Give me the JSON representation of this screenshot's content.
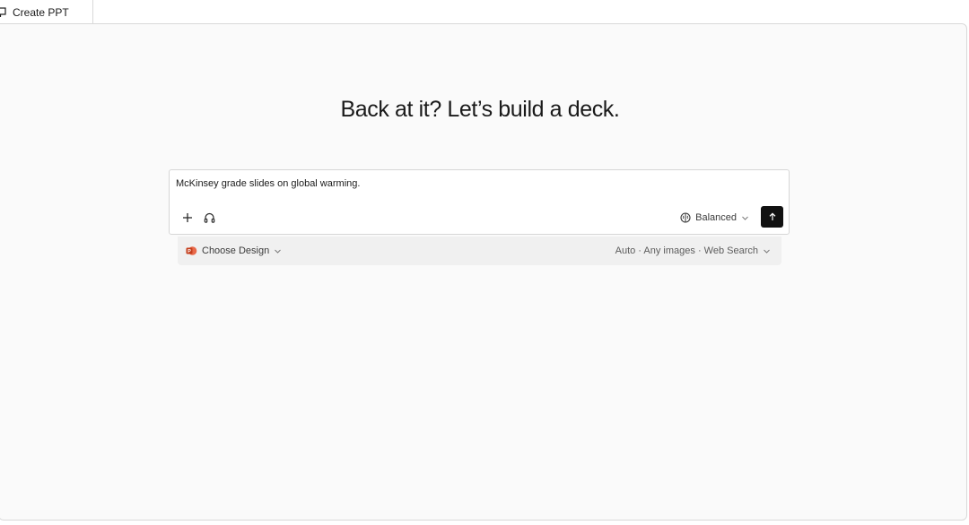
{
  "tab": {
    "label": "Create PPT",
    "icon": "presentation-icon"
  },
  "hero": {
    "title": "Back at it? Let’s build a deck."
  },
  "prompt": {
    "value": "McKinsey grade slides on global warming.",
    "add_icon": "plus-icon",
    "voice_icon": "headphones-icon",
    "mode_label": "Balanced",
    "mode_icon": "brain-icon",
    "send_icon": "arrow-up-icon"
  },
  "options": {
    "design_label": "Choose Design",
    "design_icon": "powerpoint-icon",
    "design_icon_color": "#d35230",
    "settings_label": "Auto · Any images · Web Search"
  },
  "colors": {
    "send_button": "#111111",
    "panel_bg": "#fafafa",
    "options_bg": "#f0f0f0"
  }
}
